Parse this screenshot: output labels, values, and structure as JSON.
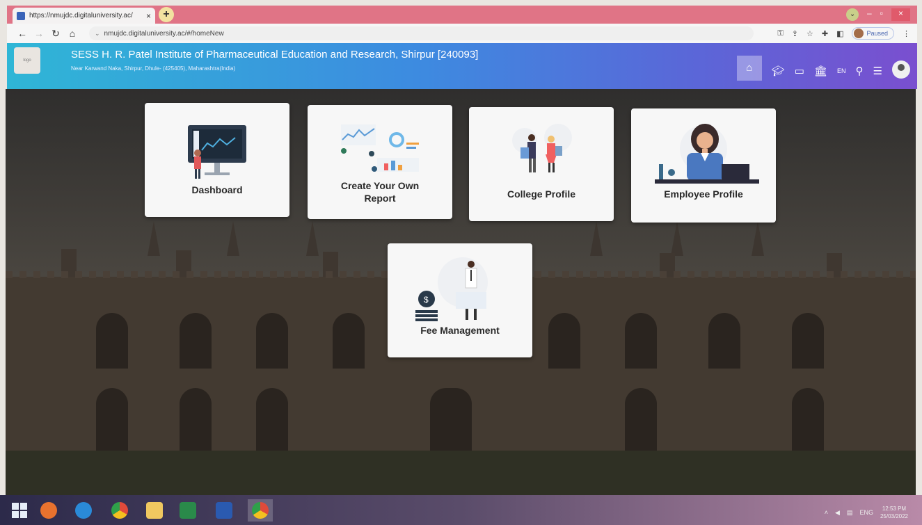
{
  "browser": {
    "tab_title": "https://nmujdc.digitaluniversity.ac/",
    "tab_close": "×",
    "new_tab": "+",
    "url": "nmujdc.digitaluniversity.ac/#/homeNew",
    "profile_status": "Paused",
    "win_dropdown": "⌄",
    "win_min": "–",
    "win_max": "▫",
    "win_close": "×"
  },
  "header": {
    "logo_text": "logo",
    "institute_name": "SESS H. R. Patel Institute of Pharmaceutical Education and Research, Shirpur [240093]",
    "institute_address": "Near Karwand Naka, Shirpur, Dhule- (425405), Maharashtra(India)",
    "language": "EN"
  },
  "cards": {
    "dashboard": "Dashboard",
    "create_report_line1": "Create Your Own",
    "create_report_line2": "Report",
    "college_profile": "College Profile",
    "employee_profile": "Employee Profile",
    "fee_management": "Fee Management"
  },
  "taskbar": {
    "lang": "ENG",
    "time": "12:53 PM",
    "date": "25/03/2022"
  },
  "colors": {
    "header_gradient_start": "#2fb6d6",
    "header_gradient_end": "#7a4fcf",
    "card_bg": "#f7f7f7",
    "tab_strip": "#e07486"
  },
  "icons": [
    "home-icon",
    "graduation-cap-icon",
    "book-icon",
    "bank-icon",
    "search-icon",
    "menu-icon",
    "user-avatar-icon"
  ]
}
